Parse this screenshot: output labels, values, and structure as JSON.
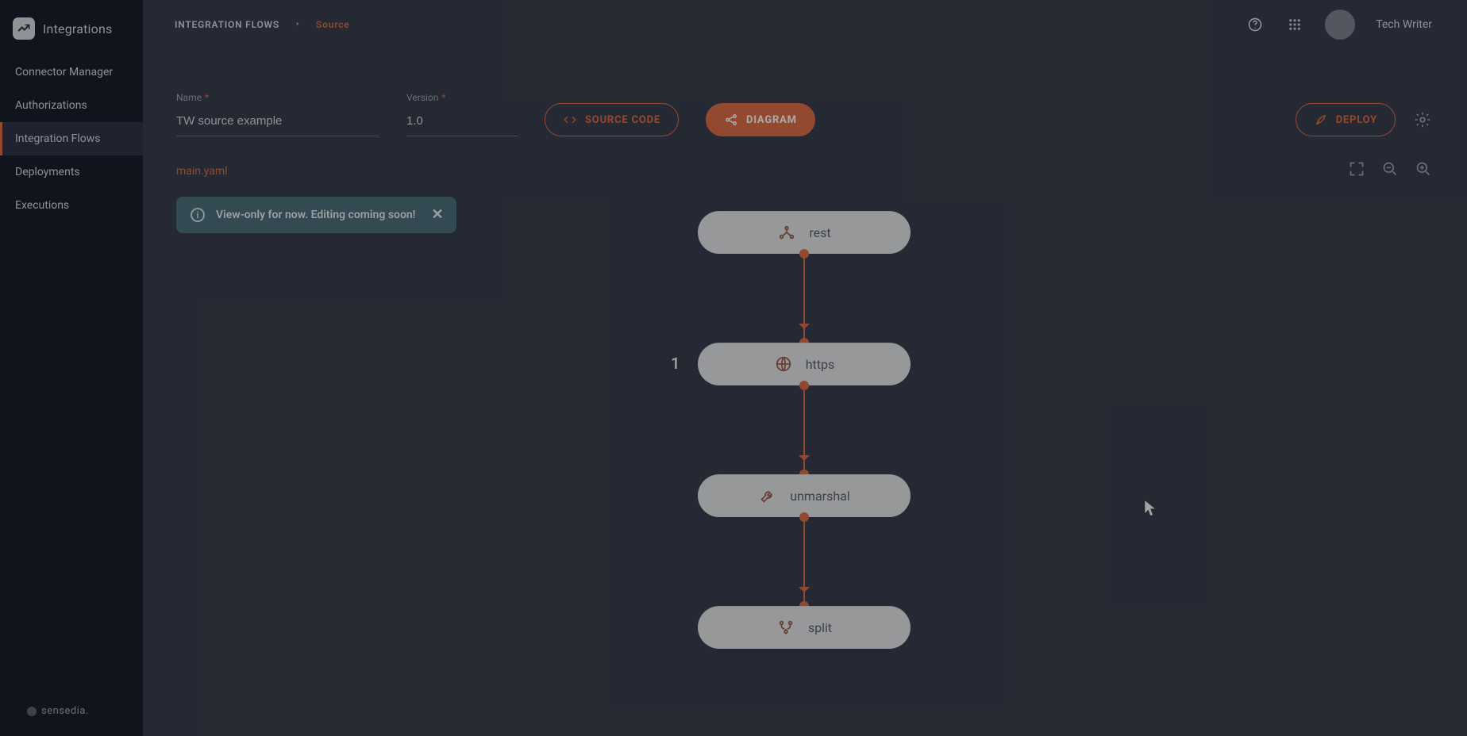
{
  "brand": {
    "title": "Integrations",
    "vendor": "sensedia."
  },
  "sidebar": {
    "items": [
      {
        "label": "Connector Manager"
      },
      {
        "label": "Authorizations"
      },
      {
        "label": "Integration Flows"
      },
      {
        "label": "Deployments"
      },
      {
        "label": "Executions"
      }
    ],
    "active_index": 2
  },
  "topbar": {
    "breadcrumb_root": "INTEGRATION FLOWS",
    "breadcrumb_leaf": "Source",
    "user_name": "Tech Writer"
  },
  "form": {
    "name_label": "Name",
    "name_value": "TW source example",
    "version_label": "Version",
    "version_value": "1.0",
    "source_code_label": "SOURCE CODE",
    "diagram_label": "DIAGRAM",
    "deploy_label": "DEPLOY"
  },
  "canvas": {
    "file_tab": "main.yaml",
    "alert_text": "View-only for now. Editing coming soon!"
  },
  "flow": {
    "nodes": [
      {
        "label": "rest",
        "icon": "graph-icon",
        "step": ""
      },
      {
        "label": "https",
        "icon": "globe-icon",
        "step": "1"
      },
      {
        "label": "unmarshal",
        "icon": "wrench-icon",
        "step": ""
      },
      {
        "label": "split",
        "icon": "branch-icon",
        "step": ""
      }
    ]
  }
}
